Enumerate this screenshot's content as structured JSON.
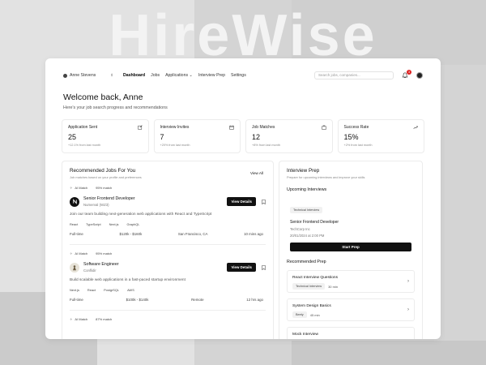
{
  "hero_text": "HireWise",
  "nav": {
    "user_name": "Anne Stevens",
    "links": [
      "Dashboard",
      "Jobs",
      "Applications",
      "Interview Prep",
      "Settings"
    ],
    "applications_caret": "⌄",
    "search_placeholder": "Search jobs, companies...",
    "notification_count": "3"
  },
  "welcome": {
    "title": "Welcome back, Anne",
    "subtitle": "Here's your job search progress and recommendations"
  },
  "stats": [
    {
      "label": "Application Sent",
      "value": "25",
      "sub": "+12.1% from last month",
      "icon": "edit-icon"
    },
    {
      "label": "Interview Invites",
      "value": "7",
      "sub": "+20% from last month",
      "icon": "calendar-icon"
    },
    {
      "label": "Job Matches",
      "value": "12",
      "sub": "+8% from last month",
      "icon": "briefcase-icon"
    },
    {
      "label": "Success Rate",
      "value": "15%",
      "sub": "+2% from last month",
      "icon": "trend-up-icon"
    }
  ],
  "jobs_panel": {
    "title": "Recommended Jobs For You",
    "subtitle": "Job matches based on your profile and preferences",
    "view_all": "View All",
    "view_details": "View Details",
    "jobs": [
      {
        "ai_label": "AI Match",
        "match": "95% match",
        "title": "Senior Frontend Developer",
        "company": "Numerval (WZ3)",
        "description": "Join our team building next-generation web applications with React and TypeScript",
        "tags": [
          "React",
          "TypeScript",
          "Next.js",
          "GraphQL"
        ],
        "type": "Full-time",
        "salary": "$120k - $160k",
        "location": "San Francisco, CA",
        "posted": "10 mins ago"
      },
      {
        "ai_label": "AI Match",
        "match": "95% match",
        "title": "Software Engineer",
        "company": "Conflidir",
        "description": "Build scalable web applications in a fast-paced startup environment",
        "tags": [
          "Next.js",
          "React",
          "PostgrSQL",
          "AWS"
        ],
        "type": "Full-time",
        "salary": "$100k - $140k",
        "location": "Remote",
        "posted": "12 hrs ago"
      },
      {
        "ai_label": "AI Match",
        "match": "87% match"
      }
    ]
  },
  "prep_panel": {
    "title": "Interview Prep",
    "subtitle": "Prepare for upcoming interviews and improve your skills",
    "upcoming_title": "Upcoming Interviews",
    "upcoming": {
      "chip": "Technical Interview",
      "title": "Senior Frontend Developer",
      "company": "TechCorp Inc",
      "datetime": "20/01/2024 at 2:00 PM",
      "button": "Start Prep"
    },
    "recommended_title": "Recommended Prep",
    "items": [
      {
        "title": "React Interview Questions",
        "chip": "Technical Interview",
        "duration": "30 min"
      },
      {
        "title": "System Design Basics",
        "chip": "Beety",
        "duration": "45 min"
      },
      {
        "title": "Mock Interview",
        "chip": "",
        "duration": ""
      }
    ]
  }
}
